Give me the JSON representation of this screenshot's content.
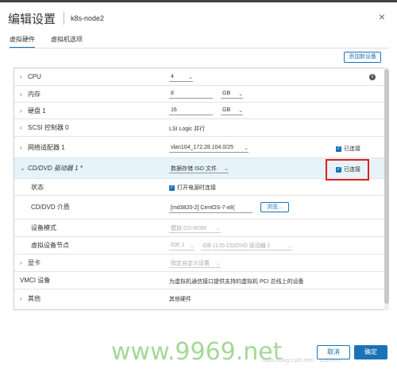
{
  "dialog": {
    "title": "编辑设置",
    "vm_name": "k8s-node2",
    "close_glyph": "×"
  },
  "tabs": [
    {
      "label": "虚拟硬件",
      "active": true
    },
    {
      "label": "虚拟机选项",
      "active": false
    }
  ],
  "toolbar": {
    "add_device_label": "添加新设备"
  },
  "hardware": {
    "cpu": {
      "label": "CPU",
      "value": "4"
    },
    "memory": {
      "label": "内存",
      "value": "8",
      "unit": "GB"
    },
    "disk": {
      "label": "硬盘 1",
      "value": "16",
      "unit": "GB"
    },
    "scsi": {
      "label": "SCSI 控制器 0",
      "value": "LSI Logic 并行"
    },
    "network": {
      "label": "网络适配器 1",
      "value": "vlan104_172.28.104.0/25",
      "connected_label": "已连接",
      "connected": true
    },
    "cdrom": {
      "label": "CD/DVD 驱动器 1 *",
      "type_value": "数据存储 ISO 文件",
      "connected_label": "已连接",
      "connected": true,
      "status_label": "状态",
      "power_on_label": "打开电源时连接",
      "power_on": true,
      "media_label": "CD/DVD 介质",
      "media_value": "[md3820-2] CentOS-7-x8(",
      "browse_label": "浏览...",
      "mode_label": "设备模式",
      "mode_value": "模拟 CD-ROM",
      "node_label": "虚拟设备节点",
      "node_bus": "IDE 1",
      "node_value": "IDE (1:0) CD/DVD 驱动器 1"
    },
    "video": {
      "label": "显卡",
      "value": "指定自定义设置"
    },
    "vmci": {
      "label": "VMCI 设备",
      "value": "为虚拟机通信接口提供支持的虚拟机 PCI 总线上的设备"
    },
    "other": {
      "label": "其他",
      "value": "其他硬件"
    }
  },
  "footer": {
    "cancel_label": "取消",
    "ok_label": "确定"
  },
  "watermark": {
    "main": "www.9969.net",
    "small": "https://blog.csdn.net/... 1184372"
  },
  "colors": {
    "accent": "#1a73b8",
    "highlight_row": "#e6f3f8",
    "annotation_red": "#e02020"
  }
}
